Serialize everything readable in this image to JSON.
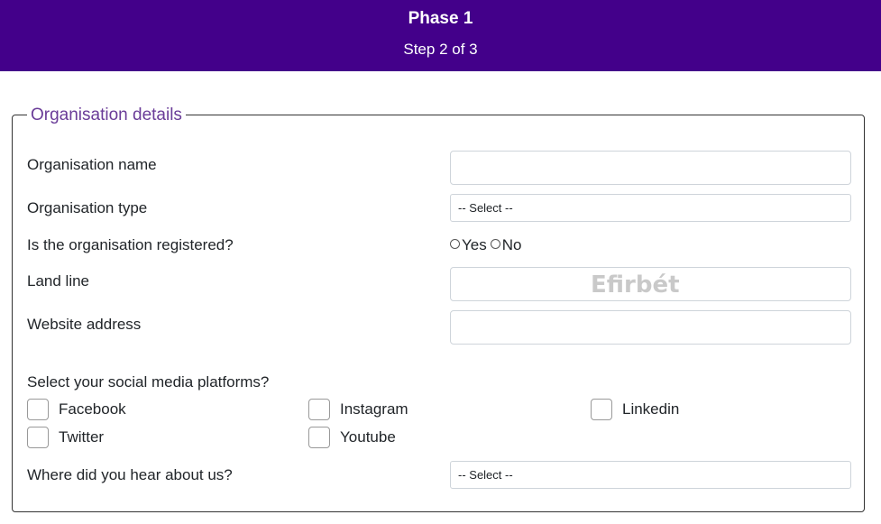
{
  "header": {
    "title": "Phase 1",
    "step": "Step 2 of 3"
  },
  "form": {
    "legend": "Organisation details",
    "org_name_label": "Organisation name",
    "org_name_value": "",
    "org_type_label": "Organisation type",
    "org_type_selected": "-- Select --",
    "registered_label": "Is the organisation registered?",
    "registered_options": [
      "Yes",
      "No"
    ],
    "landline_label": "Land line",
    "landline_value": "",
    "landline_watermark": "Efirbét",
    "website_label": "Website address",
    "website_value": "",
    "social_label": "Select your social media platforms?",
    "social_options": [
      "Facebook",
      "Instagram",
      "Linkedin",
      "Twitter",
      "Youtube"
    ],
    "hear_label": "Where did you hear about us?",
    "hear_selected": "-- Select --"
  },
  "colors": {
    "header_bg": "#43008a",
    "legend_text": "#6a3c98"
  }
}
